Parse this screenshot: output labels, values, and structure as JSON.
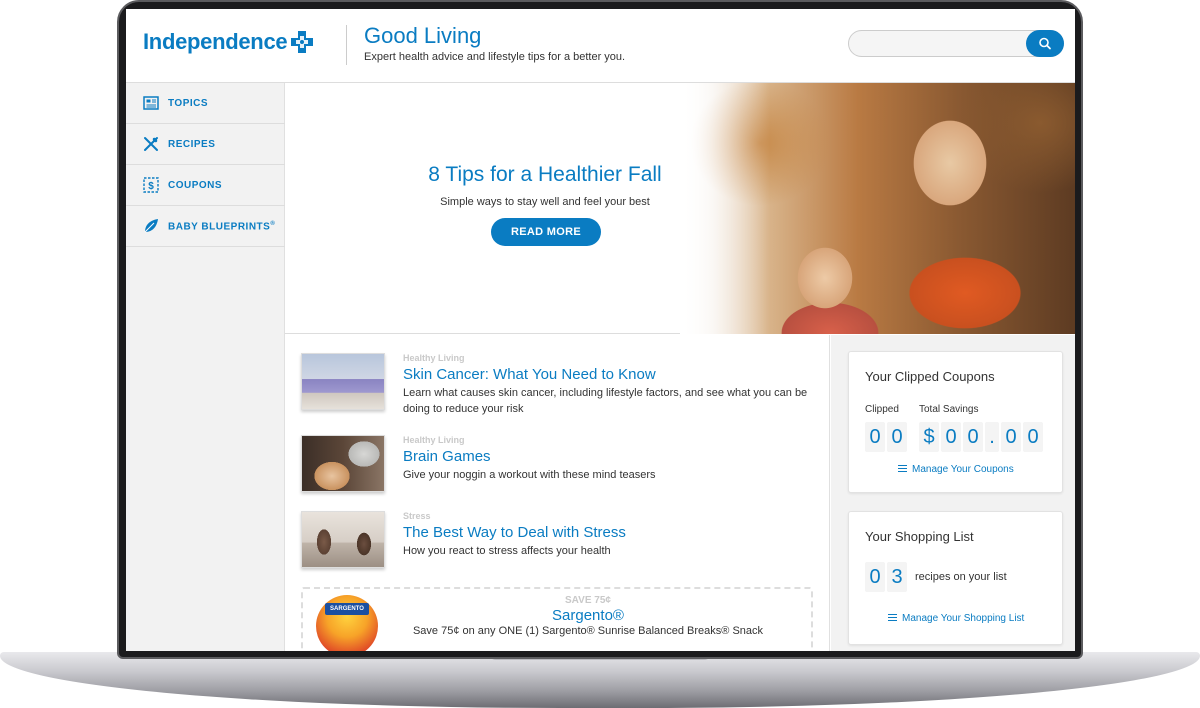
{
  "header": {
    "logo": "Independence",
    "title": "Good Living",
    "subtitle": "Expert health advice and lifestyle tips for a better you.",
    "search_placeholder": ""
  },
  "sidebar": {
    "items": [
      {
        "label": "TOPICS",
        "icon": "newspaper-icon"
      },
      {
        "label": "RECIPES",
        "icon": "utensils-icon"
      },
      {
        "label": "COUPONS",
        "icon": "coupon-icon"
      },
      {
        "label": "BABY BLUEPRINTS",
        "sup": "®",
        "icon": "leaf-icon"
      }
    ]
  },
  "hero": {
    "title": "8 Tips for a Healthier Fall",
    "subtitle": "Simple ways to stay well and feel your best",
    "button": "READ MORE"
  },
  "articles": [
    {
      "category": "Healthy Living",
      "title": "Skin Cancer: What You Need to Know",
      "desc": "Learn what causes skin cancer, including lifestyle factors, and see what you can be doing to reduce your risk"
    },
    {
      "category": "Healthy Living",
      "title": "Brain Games",
      "desc": "Give your noggin a workout with these mind teasers"
    },
    {
      "category": "Stress",
      "title": "The Best Way to Deal with Stress",
      "desc": "How you react to stress affects your health"
    }
  ],
  "coupon": {
    "save": "SAVE 75¢",
    "title": "Sargento®",
    "desc": "Save 75¢ on any ONE (1) Sargento® Sunrise Balanced Breaks® Snack",
    "thumb_label": "SARGENTO"
  },
  "clipped_coupons": {
    "title": "Your Clipped Coupons",
    "clipped_label": "Clipped",
    "savings_label": "Total Savings",
    "clipped_digits": [
      "0",
      "0"
    ],
    "savings_chars": [
      "$",
      "0",
      "0",
      ".",
      "0",
      "0"
    ],
    "link": "Manage Your Coupons"
  },
  "shopping_list": {
    "title": "Your Shopping List",
    "digits": [
      "0",
      "3"
    ],
    "suffix": "recipes on your list",
    "link": "Manage Your Shopping List"
  },
  "colors": {
    "brand_blue": "#0a7cc2",
    "muted_category": "#c9c9c9"
  }
}
